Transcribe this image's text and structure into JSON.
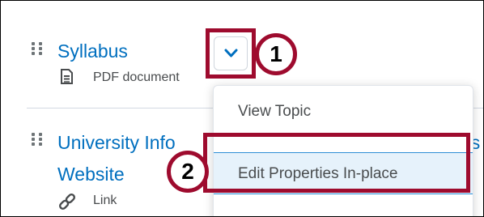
{
  "content_items": [
    {
      "title": "Syllabus",
      "type_label": "PDF document",
      "type_icon": "document-icon"
    },
    {
      "title_line1": "University Info",
      "title_tail": "es",
      "title_line2": "Website",
      "type_label": "Link",
      "type_icon": "link-icon"
    }
  ],
  "item_actions": {
    "toggle_icon": "chevron-down-icon"
  },
  "context_menu": {
    "items": [
      {
        "label": "View Topic"
      },
      {
        "label": "Edit Properties In-place",
        "selected": true
      }
    ]
  },
  "annotations": {
    "step1": "1",
    "step2": "2",
    "highlight_color": "#9e0b2e"
  },
  "colors": {
    "link": "#006fbf",
    "meta_text": "#494c4e",
    "selected_bg": "#e6f2fb",
    "selected_border": "#2e8fd6"
  }
}
